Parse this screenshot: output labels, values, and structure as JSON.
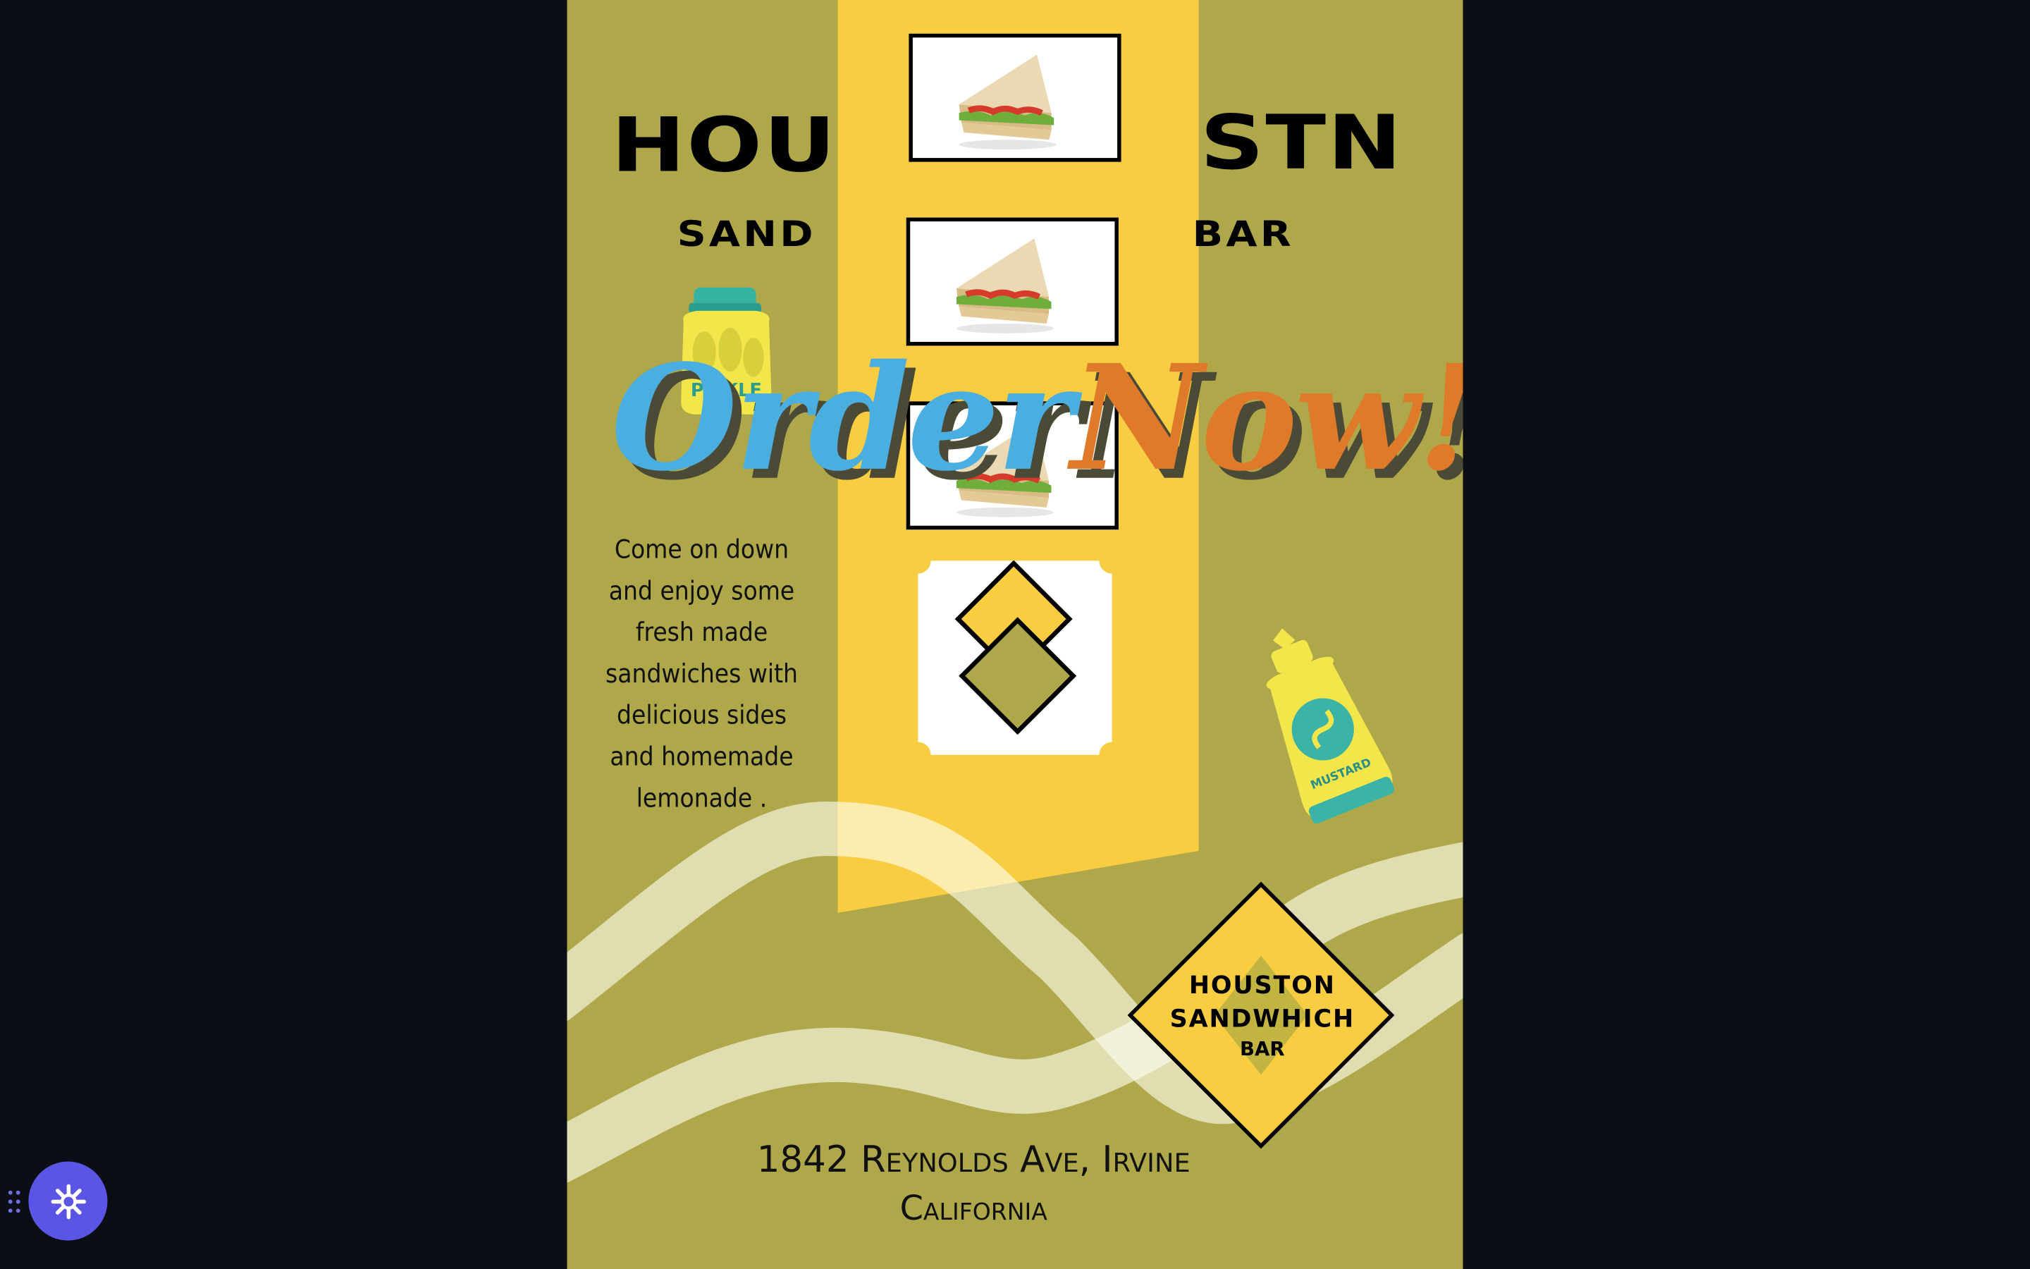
{
  "poster": {
    "title_left": "HOU",
    "title_right": "STN",
    "subtitle_left": "SAND",
    "subtitle_right": "BAR",
    "cta_word1": "Order",
    "cta_word2": "Now!",
    "blurb": "Come on down and enjoy some fresh made sandwiches with delicious sides and homemade lemonade .",
    "jar_label": "PICKLE",
    "mustard_label": "MUSTARD",
    "badge": {
      "line1": "HOUSTON",
      "line2": "SANDWHICH",
      "line3": "BAR"
    },
    "address_line1": "1842 Reynolds Ave, Irvine",
    "address_line2": "California"
  },
  "photos": [
    {
      "alt": "sandwich-photo"
    },
    {
      "alt": "sandwich-photo"
    },
    {
      "alt": "sandwich-photo"
    }
  ],
  "icons": {
    "assistant": "asterisk-icon",
    "grip": "drag-handle-icon"
  },
  "colors": {
    "background": "#0b0e14",
    "poster_olive": "#aea84a",
    "band_yellow": "#f8cd42",
    "order_blue": "#4aaee0",
    "now_orange": "#e07a2b",
    "assistant_purple": "#5b55e6"
  }
}
